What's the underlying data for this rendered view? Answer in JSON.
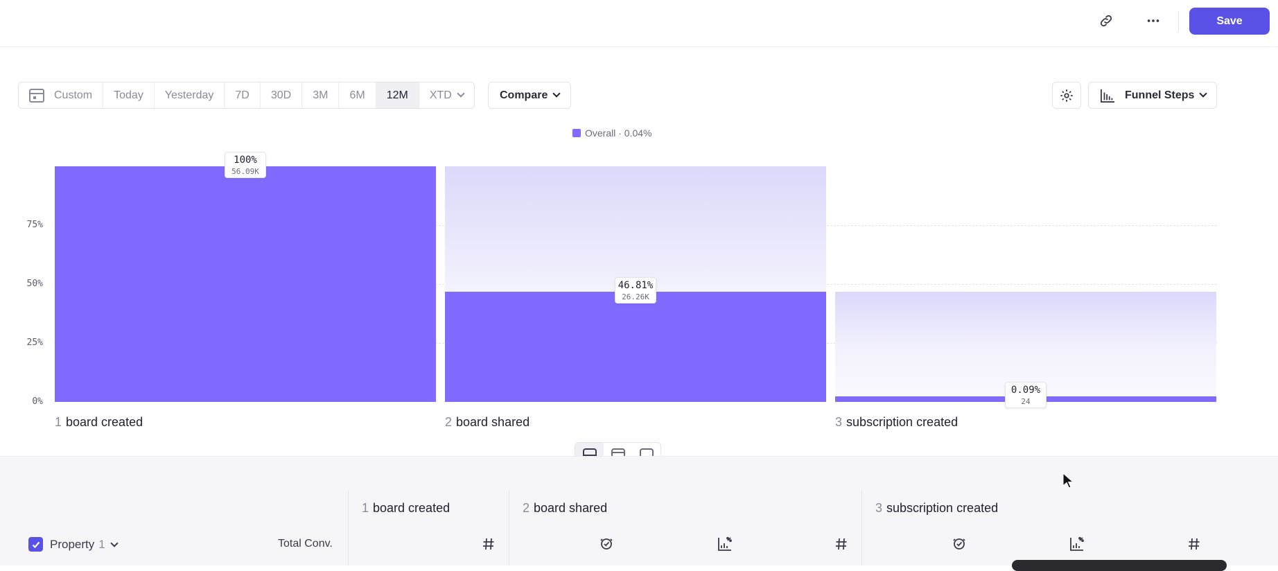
{
  "toolbar": {
    "link_icon": "link-icon",
    "more_icon": "more-horizontal-icon",
    "save_label": "Save",
    "accent": "#5a51e6"
  },
  "date_range": {
    "options": [
      "Custom",
      "Today",
      "Yesterday",
      "7D",
      "30D",
      "3M",
      "6M",
      "12M",
      "XTD"
    ],
    "selected": "12M"
  },
  "compare_label": "Compare",
  "chart_type_label": "Funnel Steps",
  "legend": {
    "label": "Overall · 0.04%",
    "color": "#7f6bff"
  },
  "chart_data": {
    "type": "bar",
    "categories": [
      "board created",
      "board shared",
      "subscription created"
    ],
    "step_numbers": [
      "1",
      "2",
      "3"
    ],
    "series": [
      {
        "name": "Overall",
        "values": [
          100,
          46.81,
          0.09
        ]
      }
    ],
    "percent_labels": [
      "100%",
      "46.81%",
      "0.09%"
    ],
    "count_labels": [
      "56.09K",
      "26.26K",
      "24"
    ],
    "y_ticks": [
      "0%",
      "25%",
      "50%",
      "75%"
    ],
    "ylim": [
      0,
      100
    ],
    "previous_step_reference": [
      100,
      100,
      46.81
    ],
    "grid": true,
    "legend_position": "top-center"
  },
  "view_toggle": [
    "split-view-icon",
    "top-panel-icon",
    "bottom-panel-icon"
  ],
  "table": {
    "property_label": "Property",
    "property_count": "1",
    "total_conv_label": "Total Conv.",
    "steps": [
      {
        "num": "1",
        "label": "board created"
      },
      {
        "num": "2",
        "label": "board shared"
      },
      {
        "num": "3",
        "label": "subscription created"
      }
    ]
  }
}
